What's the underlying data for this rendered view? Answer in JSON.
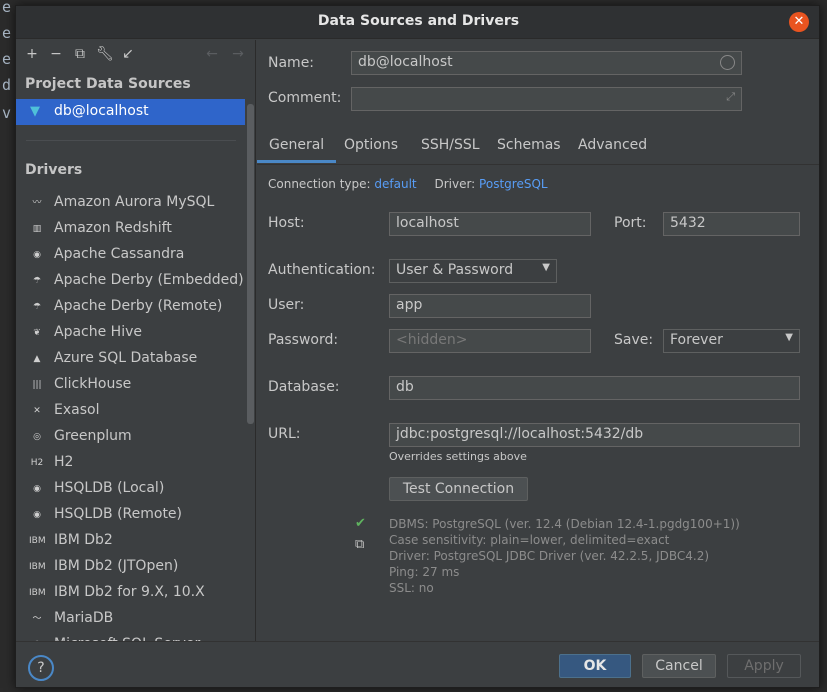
{
  "background": {
    "lines": [
      "e",
      "e",
      "e",
      "d",
      "v"
    ]
  },
  "dialog": {
    "title": "Data Sources and Drivers",
    "close_symbol": "✕"
  },
  "left": {
    "project_sources_title": "Project Data Sources",
    "selected_source": "db@localhost",
    "drivers_title": "Drivers",
    "drivers": [
      {
        "label": "Amazon Aurora MySQL",
        "icon": "aurora-icon",
        "glyph": "〰"
      },
      {
        "label": "Amazon Redshift",
        "icon": "redshift-icon",
        "glyph": "▥"
      },
      {
        "label": "Apache Cassandra",
        "icon": "cassandra-icon",
        "glyph": "◉"
      },
      {
        "label": "Apache Derby (Embedded)",
        "icon": "derby-icon",
        "glyph": "☂"
      },
      {
        "label": "Apache Derby (Remote)",
        "icon": "derby-icon",
        "glyph": "☂"
      },
      {
        "label": "Apache Hive",
        "icon": "hive-icon",
        "glyph": "❦"
      },
      {
        "label": "Azure SQL Database",
        "icon": "azure-icon",
        "glyph": "▲"
      },
      {
        "label": "ClickHouse",
        "icon": "clickhouse-icon",
        "glyph": "|||"
      },
      {
        "label": "Exasol",
        "icon": "exasol-icon",
        "glyph": "✕"
      },
      {
        "label": "Greenplum",
        "icon": "greenplum-icon",
        "glyph": "◎"
      },
      {
        "label": "H2",
        "icon": "h2-icon",
        "glyph": "H2"
      },
      {
        "label": "HSQLDB (Local)",
        "icon": "hsqldb-icon",
        "glyph": "◉"
      },
      {
        "label": "HSQLDB (Remote)",
        "icon": "hsqldb-icon",
        "glyph": "◉"
      },
      {
        "label": "IBM Db2",
        "icon": "db2-icon",
        "glyph": "IBM"
      },
      {
        "label": "IBM Db2 (JTOpen)",
        "icon": "db2-icon",
        "glyph": "IBM"
      },
      {
        "label": "IBM Db2 for 9.X, 10.X",
        "icon": "db2-icon",
        "glyph": "IBM"
      },
      {
        "label": "MariaDB",
        "icon": "mariadb-icon",
        "glyph": "〜"
      },
      {
        "label": "Microsoft SQL Server",
        "icon": "sqlserver-icon",
        "glyph": "⚙"
      }
    ]
  },
  "right": {
    "name_label": "Name:",
    "name_value": "db@localhost",
    "comment_label": "Comment:",
    "comment_value": "",
    "tabs": [
      "General",
      "Options",
      "SSH/SSL",
      "Schemas",
      "Advanced"
    ],
    "connection_type_label": "Connection type:",
    "connection_type_value": "default",
    "driver_label": "Driver:",
    "driver_value": "PostgreSQL",
    "host_label": "Host:",
    "host_value": "localhost",
    "port_label": "Port:",
    "port_value": "5432",
    "auth_label": "Authentication:",
    "auth_value": "User & Password",
    "user_label": "User:",
    "user_value": "app",
    "password_label": "Password:",
    "password_value": "<hidden>",
    "save_label": "Save:",
    "save_value": "Forever",
    "database_label": "Database:",
    "database_value": "db",
    "url_label": "URL:",
    "url_value": "jdbc:postgresql://localhost:5432/db",
    "url_hint": "Overrides settings above",
    "test_button": "Test Connection",
    "info_lines": [
      "DBMS: PostgreSQL (ver. 12.4 (Debian 12.4-1.pgdg100+1))",
      "Case sensitivity: plain=lower, delimited=exact",
      "Driver: PostgreSQL JDBC Driver (ver. 42.2.5, JDBC4.2)",
      "Ping: 27 ms",
      "SSL: no"
    ]
  },
  "footer": {
    "help": "?",
    "ok": "OK",
    "cancel": "Cancel",
    "apply": "Apply"
  },
  "colors": {
    "accent": "#2f65ca",
    "link": "#589df6",
    "success": "#5fb35f",
    "close": "#e95420"
  }
}
